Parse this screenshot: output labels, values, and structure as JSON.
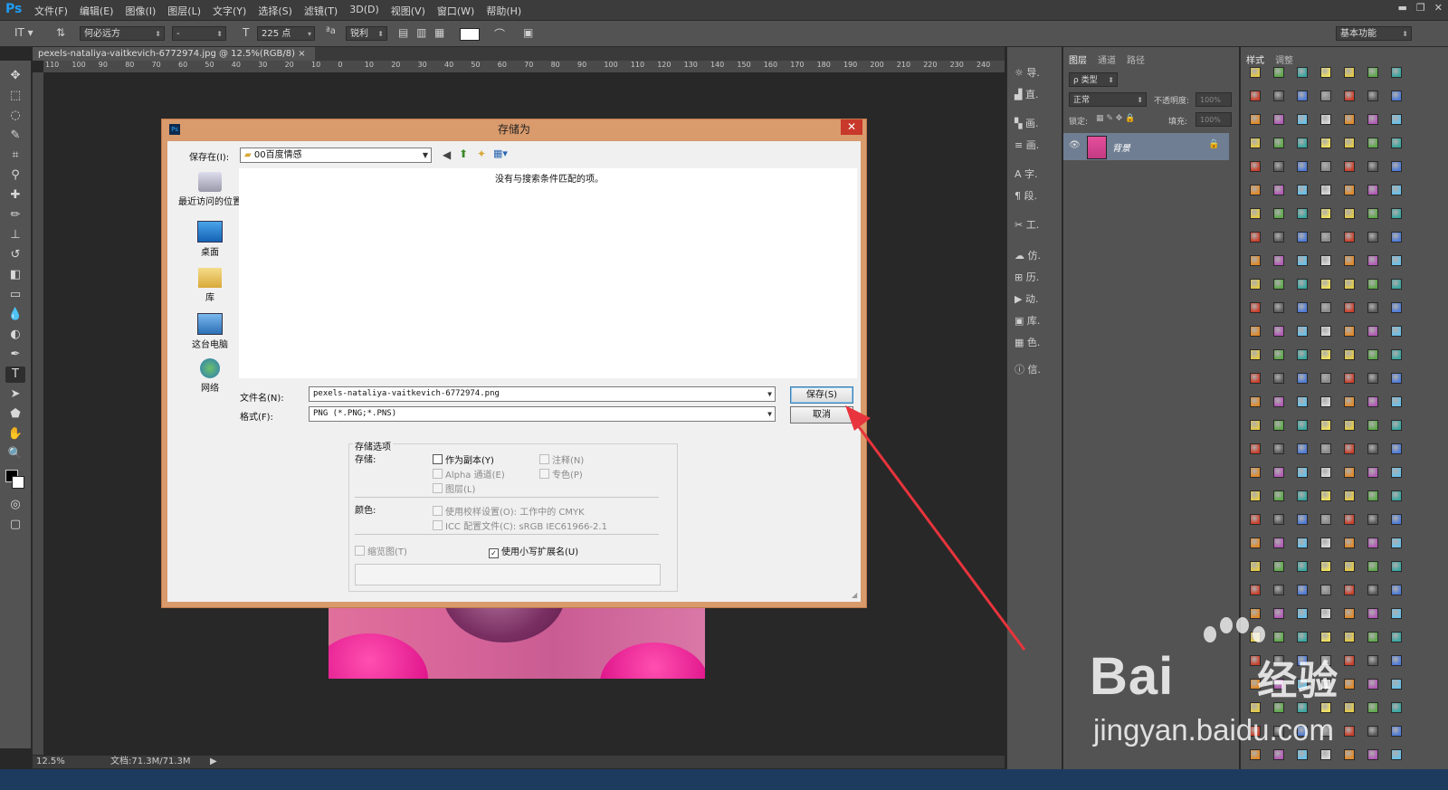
{
  "menubar": {
    "logo": "Ps",
    "items": [
      "文件(F)",
      "编辑(E)",
      "图像(I)",
      "图层(L)",
      "文字(Y)",
      "选择(S)",
      "滤镜(T)",
      "3D(D)",
      "视图(V)",
      "窗口(W)",
      "帮助(H)"
    ]
  },
  "optbar": {
    "font_family": "何必远方",
    "font_style": "-",
    "font_size": "225 点",
    "aa_label": "ªa",
    "aa_mode": "锐利",
    "workspace": "基本功能"
  },
  "document": {
    "tab_title": "pexels-nataliya-vaitkevich-6772974.jpg @ 12.5%(RGB/8)",
    "zoom": "12.5%",
    "doc_size": "文档:71.3M/71.3M",
    "hruler": [
      "110",
      "100",
      "90",
      "80",
      "70",
      "60",
      "50",
      "40",
      "30",
      "20",
      "10",
      "0",
      "10",
      "20",
      "30",
      "40",
      "50",
      "60",
      "70",
      "80",
      "90",
      "100",
      "110",
      "120",
      "130",
      "140",
      "150",
      "160",
      "170",
      "180",
      "190",
      "200",
      "210",
      "220",
      "230",
      "240"
    ]
  },
  "midpanel": {
    "items": [
      "导.",
      "直.",
      "画.",
      "画.",
      "字.",
      "段.",
      "工.",
      "仿.",
      "历.",
      "动.",
      "库.",
      "色.",
      "信."
    ]
  },
  "layers_panel": {
    "tabs": [
      "图层",
      "通道",
      "路径"
    ],
    "kind_filter": "ρ 类型",
    "blend_mode": "正常",
    "opacity_label": "不透明度:",
    "opacity_value": "100%",
    "lock_label": "锁定:",
    "fill_label": "填充:",
    "fill_value": "100%",
    "layer_name": "背景"
  },
  "styles_panel": {
    "tabs": [
      "样式",
      "调整"
    ]
  },
  "dialog": {
    "title": "存储为",
    "save_in_label": "保存在(I):",
    "save_in_value": "00百度情感",
    "empty_message": "没有与搜索条件匹配的项。",
    "places": [
      "最近访问的位置",
      "桌面",
      "库",
      "这台电脑",
      "网络"
    ],
    "filename_label": "文件名(N):",
    "filename_value": "pexels-nataliya-vaitkevich-6772974.png",
    "format_label": "格式(F):",
    "format_value": "PNG (*.PNG;*.PNS)",
    "save_button": "保存(S)",
    "cancel_button": "取消",
    "options_group": "存储选项",
    "store_label": "存储:",
    "as_copy": "作为副本(Y)",
    "notes": "注释(N)",
    "alpha": "Alpha 通道(E)",
    "spot": "专色(P)",
    "layers": "图层(L)",
    "color_label": "颜色:",
    "proof_setup": "使用校样设置(O): 工作中的 CMYK",
    "icc_profile": "ICC 配置文件(C): sRGB IEC61966-2.1",
    "thumbnail": "缩览图(T)",
    "lowercase_ext": "使用小写扩展名(U)"
  },
  "watermark": {
    "brand": "Bai",
    "brand2": "经验",
    "url": "jingyan.baidu.com"
  },
  "colors": {
    "annotation_arrow": "#e8343c"
  }
}
